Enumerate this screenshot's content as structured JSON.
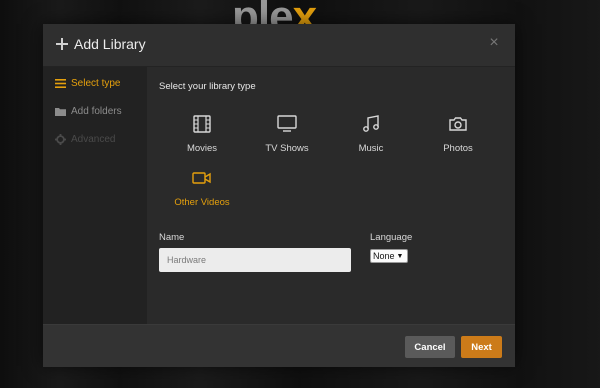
{
  "brand": {
    "logo_main": "ple",
    "logo_x": "x"
  },
  "dialog": {
    "title": "Add Library",
    "close_symbol": "×"
  },
  "sidebar": {
    "items": [
      {
        "label": "Select type",
        "icon": "list-icon",
        "state": "active"
      },
      {
        "label": "Add folders",
        "icon": "folder-icon",
        "state": "inactive"
      },
      {
        "label": "Advanced",
        "icon": "gear-icon",
        "state": "disabled"
      }
    ]
  },
  "main": {
    "section_title": "Select your library type",
    "types": [
      {
        "label": "Movies",
        "icon": "film-icon",
        "selected": false
      },
      {
        "label": "TV Shows",
        "icon": "tv-icon",
        "selected": false
      },
      {
        "label": "Music",
        "icon": "music-note-icon",
        "selected": false
      },
      {
        "label": "Photos",
        "icon": "camera-icon",
        "selected": false
      },
      {
        "label": "Other Videos",
        "icon": "video-camera-icon",
        "selected": true
      }
    ],
    "name_label": "Name",
    "name_value": "Hardware",
    "language_label": "Language",
    "language_value": "None"
  },
  "footer": {
    "cancel_label": "Cancel",
    "next_label": "Next"
  },
  "colors": {
    "accent": "#e5a00d",
    "next_button": "#cc7b19",
    "cancel_button": "#5a5a5a"
  }
}
